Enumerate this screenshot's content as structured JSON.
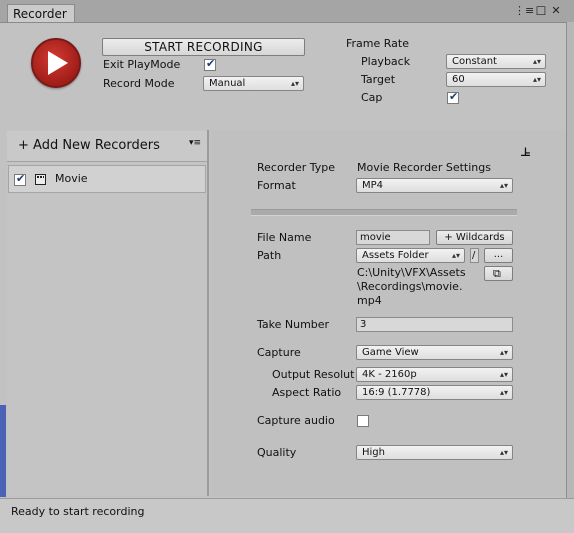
{
  "window": {
    "tab_title": "Recorder",
    "menu_icon": "⋮≡",
    "maximize_icon": "☐",
    "close_icon": "✕"
  },
  "header": {
    "start_button": "START RECORDING",
    "exit_playmode_label": "Exit PlayMode",
    "exit_playmode_checked": true,
    "record_mode_label": "Record Mode",
    "record_mode_value": "Manual",
    "frame_rate_label": "Frame Rate",
    "playback_label": "Playback",
    "playback_value": "Constant",
    "target_label": "Target",
    "target_value": "60",
    "cap_label": "Cap",
    "cap_checked": true
  },
  "left_panel": {
    "add_new_recorders": "+ Add New Recorders",
    "options_icon": "▾≡",
    "recorders": [
      {
        "label": "Movie",
        "enabled": true,
        "icon": "clapperboard-icon"
      }
    ]
  },
  "settings": {
    "recorder_type_label": "Recorder Type",
    "recorder_type_value": "Movie Recorder Settings",
    "preset_icon": "sliders-icon",
    "format_label": "Format",
    "format_value": "MP4",
    "file_name_label": "File Name",
    "file_name_value": "movie",
    "wildcards_button": "+ Wildcards",
    "path_label": "Path",
    "path_value": "Assets Folder",
    "path_separator": "/",
    "browse_button": "...",
    "full_path_line1": "C:\\Unity\\VFX\\Assets",
    "full_path_line2": "\\Recordings\\movie.",
    "full_path_line3": "mp4",
    "take_number_label": "Take Number",
    "take_number_value": "3",
    "capture_label": "Capture",
    "capture_value": "Game View",
    "output_resolution_label": "Output Resolut",
    "output_resolution_value": "4K - 2160p",
    "aspect_ratio_label": "Aspect Ratio",
    "aspect_ratio_value": "16:9 (1.7778)",
    "capture_audio_label": "Capture audio",
    "capture_audio_checked": false,
    "quality_label": "Quality",
    "quality_value": "High"
  },
  "status": {
    "text": "Ready to start recording"
  },
  "colors": {
    "record_red": "#b4241d",
    "panel_gray": "#c2c2c2",
    "check_blue": "#1c3d77"
  }
}
